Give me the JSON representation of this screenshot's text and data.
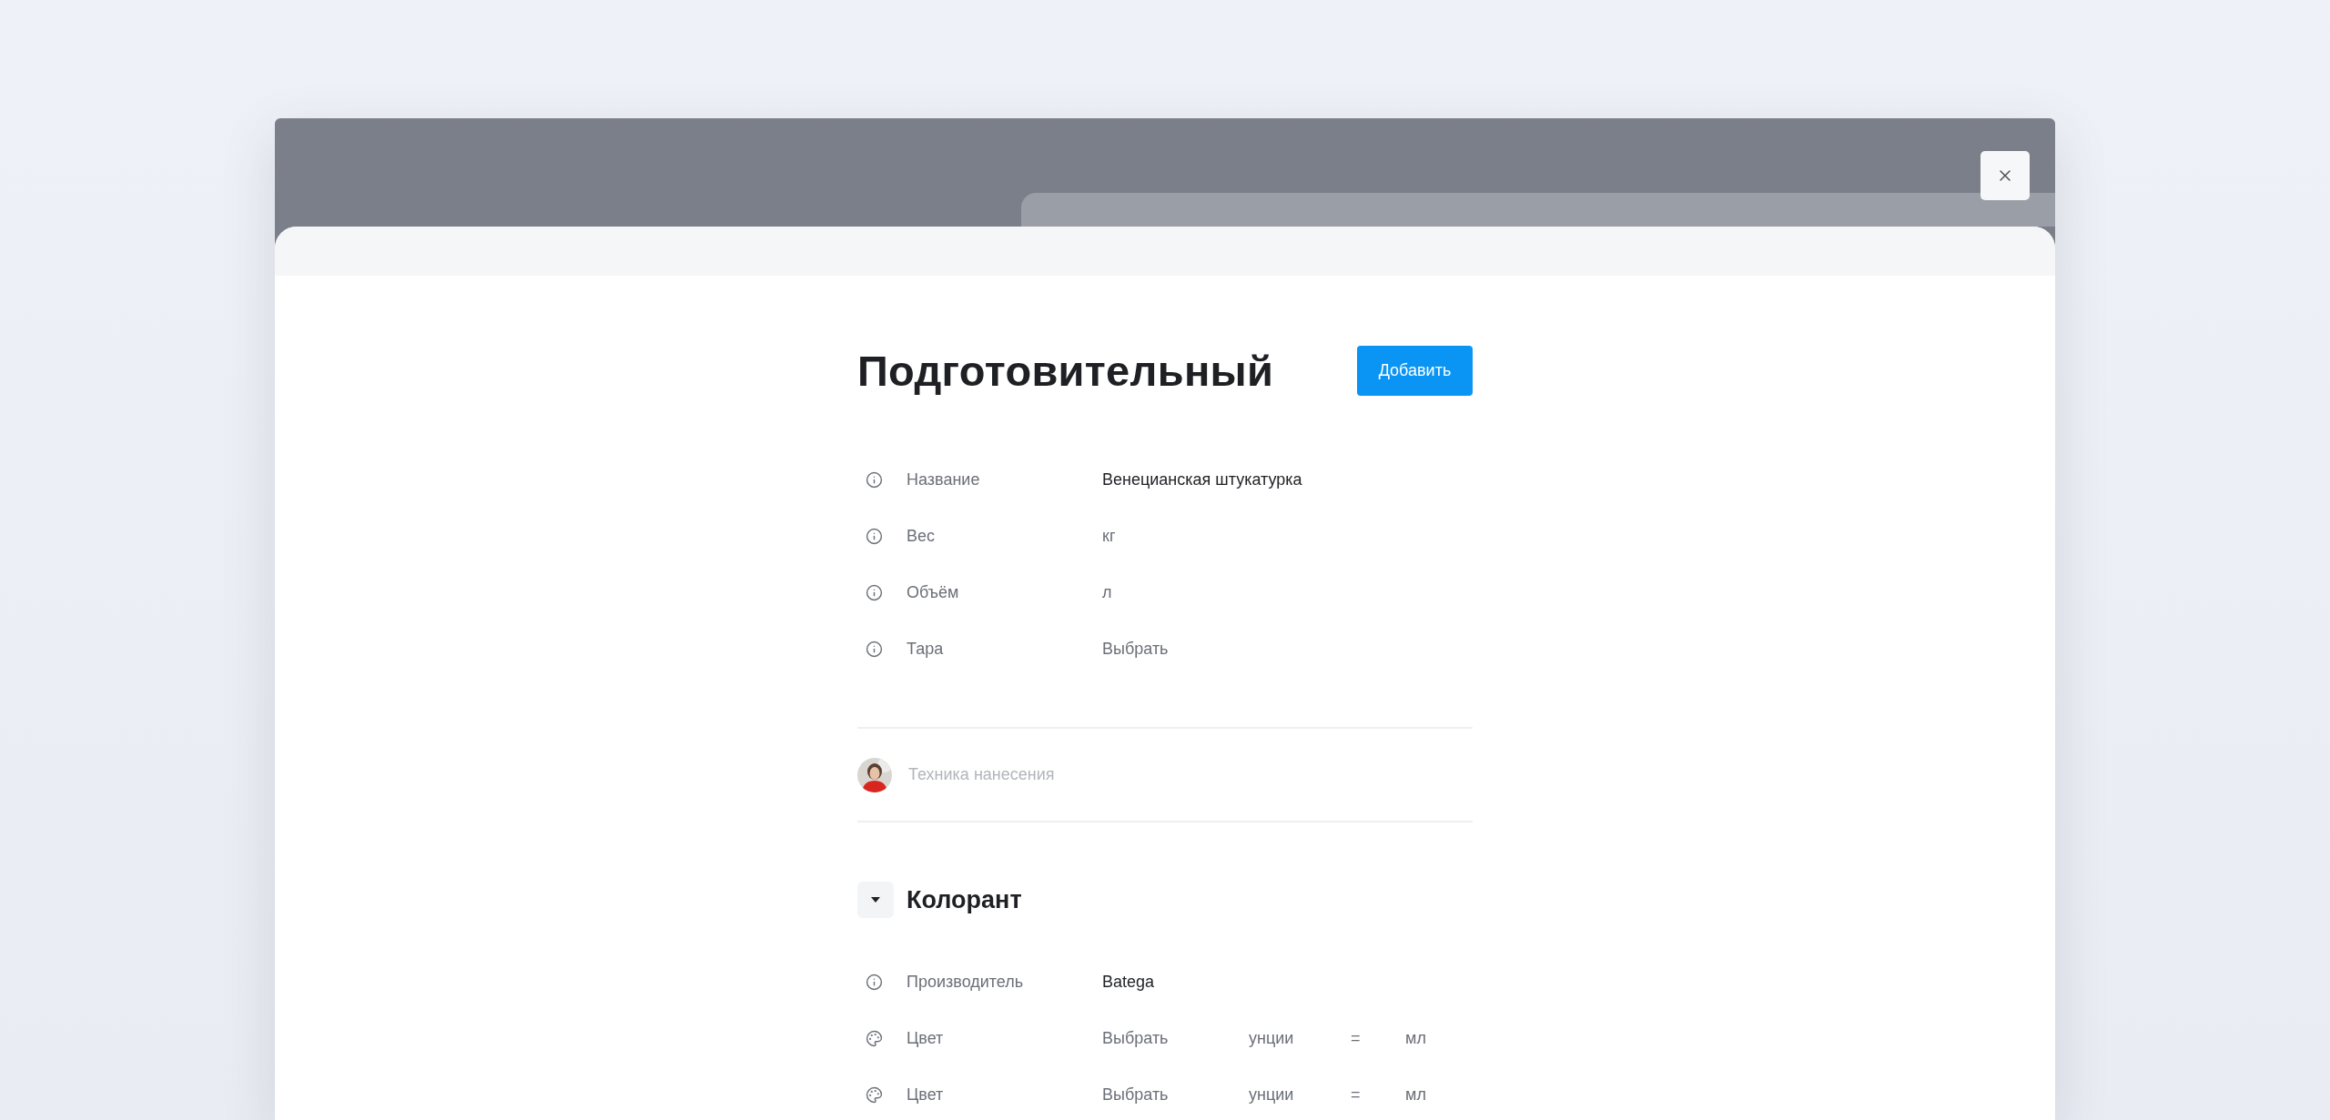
{
  "title": "Подготовительный",
  "add_button": "Добавить",
  "fields": [
    {
      "kind": "info",
      "label": "Название",
      "value": "Венецианская штукатурка",
      "filled": true
    },
    {
      "kind": "info",
      "label": "Вес",
      "value": "кг",
      "filled": false
    },
    {
      "kind": "info",
      "label": "Объём",
      "value": "л",
      "filled": false
    },
    {
      "kind": "info",
      "label": "Тара",
      "value": "Выбрать",
      "filled": false
    }
  ],
  "comment": {
    "placeholder": "Техника нанесения"
  },
  "section": {
    "title": "Колорант",
    "expanded": true,
    "rows": [
      {
        "kind": "info",
        "label": "Производитель",
        "value": "Batega",
        "filled": true
      },
      {
        "kind": "color",
        "label": "Цвет",
        "value": "Выбрать",
        "filled": false,
        "unit": "унции",
        "equals": "=",
        "result_unit": "мл"
      },
      {
        "kind": "color",
        "label": "Цвет",
        "value": "Выбрать",
        "filled": false,
        "unit": "унции",
        "equals": "=",
        "result_unit": "мл"
      }
    ]
  }
}
